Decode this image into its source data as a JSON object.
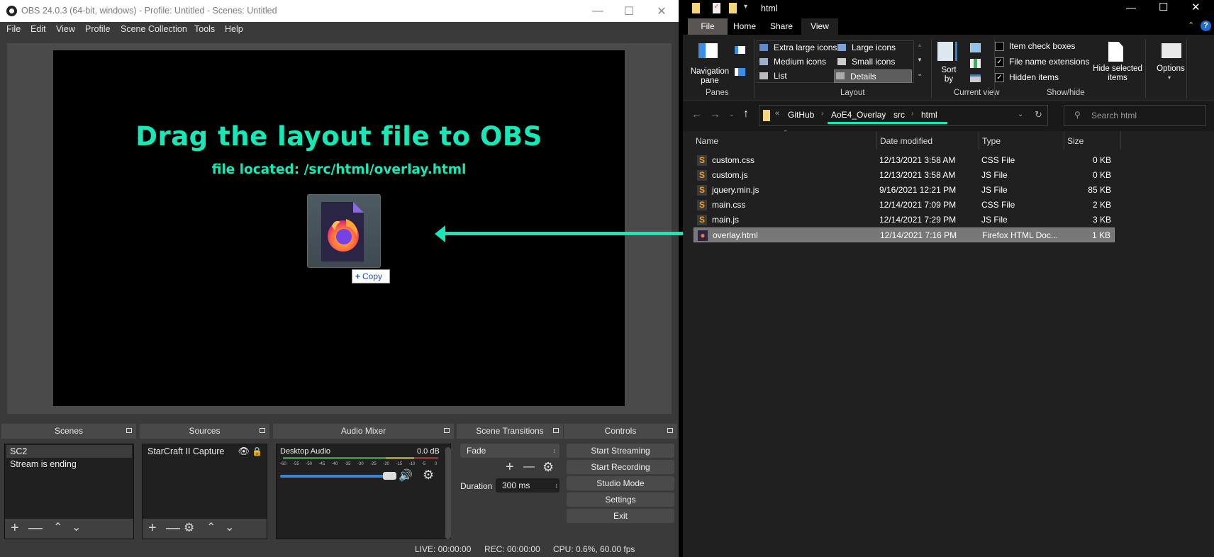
{
  "obs": {
    "title": "OBS 24.0.3 (64-bit, windows) - Profile: Untitled - Scenes: Untitled",
    "menu": [
      "File",
      "Edit",
      "View",
      "Profile",
      "Scene Collection",
      "Tools",
      "Help"
    ],
    "preview": {
      "headline": "Drag the layout file to OBS",
      "subline": "file located:  /src/html/overlay.html",
      "accent_color": "#16e8b8",
      "drag_badge": "Copy"
    },
    "docks": {
      "scenes": {
        "title": "Scenes",
        "items": [
          "SC2",
          "Stream is ending"
        ],
        "selected": 0
      },
      "sources": {
        "title": "Sources",
        "items": [
          "StarCraft II Capture"
        ]
      },
      "audio_mixer": {
        "title": "Audio Mixer",
        "channel": "Desktop Audio",
        "level": "0.0 dB",
        "ticks": [
          "-60",
          "-55",
          "-50",
          "-45",
          "-40",
          "-35",
          "-30",
          "-25",
          "-20",
          "-15",
          "-10",
          "-5",
          "0"
        ],
        "volume_fraction": 1.0
      },
      "scene_transitions": {
        "title": "Scene Transitions",
        "transition": "Fade",
        "duration_label": "Duration",
        "duration_value": "300 ms"
      },
      "controls": {
        "title": "Controls",
        "buttons": [
          "Start Streaming",
          "Start Recording",
          "Studio Mode",
          "Settings",
          "Exit"
        ]
      }
    },
    "status": {
      "live": "LIVE: 00:00:00",
      "rec": "REC: 00:00:00",
      "cpu": "CPU: 0.6%, 60.00 fps"
    }
  },
  "explorer": {
    "title": "html",
    "tabs": [
      "File",
      "Home",
      "Share",
      "View"
    ],
    "active_tab": "View",
    "ribbon": {
      "panes": {
        "label": "Panes",
        "nav_pane": "Navigation pane"
      },
      "layout": {
        "label": "Layout",
        "options": [
          "Extra large icons",
          "Large icons",
          "Medium icons",
          "Small icons",
          "List",
          "Details"
        ],
        "selected": "Details"
      },
      "current_view": {
        "label": "Current view",
        "sort_by": "Sort by"
      },
      "show_hide": {
        "label": "Show/hide",
        "item_check_boxes": "Item check boxes",
        "file_name_extensions": "File name extensions",
        "hidden_items": "Hidden items",
        "hide_selected": "Hide selected items",
        "checks": {
          "item_check_boxes": false,
          "file_name_extensions": true,
          "hidden_items": true
        }
      },
      "options": "Options"
    },
    "breadcrumb": [
      "GitHub",
      "AoE4_Overlay",
      "src",
      "html"
    ],
    "search_placeholder": "Search html",
    "columns": [
      "Name",
      "Date modified",
      "Type",
      "Size"
    ],
    "files": [
      {
        "name": "custom.css",
        "date": "12/13/2021 3:58 AM",
        "type": "CSS File",
        "size": "0 KB",
        "icon": "sublime-icon"
      },
      {
        "name": "custom.js",
        "date": "12/13/2021 3:58 AM",
        "type": "JS File",
        "size": "0 KB",
        "icon": "sublime-icon"
      },
      {
        "name": "jquery.min.js",
        "date": "9/16/2021 12:21 PM",
        "type": "JS File",
        "size": "85 KB",
        "icon": "sublime-icon"
      },
      {
        "name": "main.css",
        "date": "12/14/2021 7:09 PM",
        "type": "CSS File",
        "size": "2 KB",
        "icon": "sublime-icon"
      },
      {
        "name": "main.js",
        "date": "12/14/2021 7:29 PM",
        "type": "JS File",
        "size": "3 KB",
        "icon": "sublime-icon"
      },
      {
        "name": "overlay.html",
        "date": "12/14/2021 7:16 PM",
        "type": "Firefox HTML Doc...",
        "size": "1 KB",
        "icon": "firefox-icon",
        "selected": true
      }
    ]
  }
}
